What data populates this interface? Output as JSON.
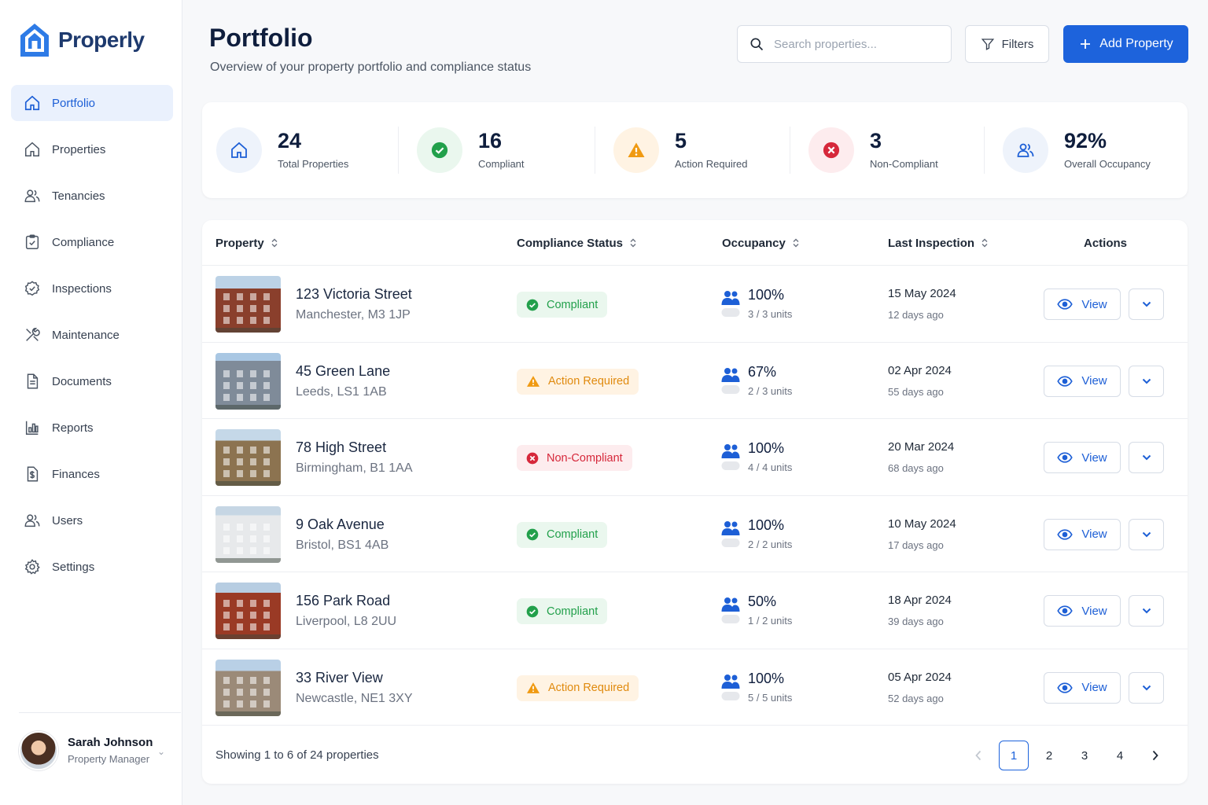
{
  "brand": {
    "name": "Properly"
  },
  "sidebar": {
    "items": [
      {
        "label": "Portfolio",
        "icon": "home-icon",
        "active": true
      },
      {
        "label": "Properties",
        "icon": "house-icon"
      },
      {
        "label": "Tenancies",
        "icon": "users-icon"
      },
      {
        "label": "Compliance",
        "icon": "clipboard-check-icon"
      },
      {
        "label": "Inspections",
        "icon": "check-circle-icon"
      },
      {
        "label": "Maintenance",
        "icon": "tools-icon"
      },
      {
        "label": "Documents",
        "icon": "document-icon"
      },
      {
        "label": "Reports",
        "icon": "bar-chart-icon"
      },
      {
        "label": "Finances",
        "icon": "money-icon"
      },
      {
        "label": "Users",
        "icon": "users-icon"
      },
      {
        "label": "Settings",
        "icon": "gear-icon"
      }
    ],
    "user": {
      "name": "Sarah Johnson",
      "role": "Property Manager"
    }
  },
  "header": {
    "title": "Portfolio",
    "subtitle": "Overview of your property portfolio and compliance status",
    "search_placeholder": "Search properties...",
    "filters_label": "Filters",
    "add_label": "Add Property"
  },
  "stats": [
    {
      "value": "24",
      "label": "Total Properties",
      "icon": "home-icon"
    },
    {
      "value": "16",
      "label": "Compliant",
      "icon": "check-circle-icon"
    },
    {
      "value": "5",
      "label": "Action Required",
      "icon": "warning-icon"
    },
    {
      "value": "3",
      "label": "Non-Compliant",
      "icon": "x-circle-icon"
    },
    {
      "value": "92%",
      "label": "Overall Occupancy",
      "icon": "users-icon"
    }
  ],
  "table": {
    "headers": {
      "property": "Property",
      "compliance": "Compliance Status",
      "occupancy": "Occupancy",
      "inspection": "Last Inspection",
      "actions": "Actions"
    },
    "view_label": "View",
    "rows": [
      {
        "name": "123 Victoria Street",
        "address": "Manchester, M3 1JP",
        "status": "Compliant",
        "status_kind": "ok",
        "occupancy": "100%",
        "units": "3 / 3 units",
        "date": "15 May 2024",
        "ago": "12 days ago"
      },
      {
        "name": "45 Green Lane",
        "address": "Leeds, LS1 1AB",
        "status": "Action Required",
        "status_kind": "warn",
        "occupancy": "67%",
        "units": "2 / 3 units",
        "date": "02 Apr 2024",
        "ago": "55 days ago"
      },
      {
        "name": "78 High Street",
        "address": "Birmingham, B1 1AA",
        "status": "Non-Compliant",
        "status_kind": "bad",
        "occupancy": "100%",
        "units": "4 / 4 units",
        "date": "20 Mar 2024",
        "ago": "68 days ago"
      },
      {
        "name": "9 Oak Avenue",
        "address": "Bristol, BS1 4AB",
        "status": "Compliant",
        "status_kind": "ok",
        "occupancy": "100%",
        "units": "2 / 2 units",
        "date": "10 May 2024",
        "ago": "17 days ago"
      },
      {
        "name": "156 Park Road",
        "address": "Liverpool, L8 2UU",
        "status": "Compliant",
        "status_kind": "ok",
        "occupancy": "50%",
        "units": "1 / 2 units",
        "date": "18 Apr 2024",
        "ago": "39 days ago"
      },
      {
        "name": "33 River View",
        "address": "Newcastle, NE1 3XY",
        "status": "Action Required",
        "status_kind": "warn",
        "occupancy": "100%",
        "units": "5 / 5 units",
        "date": "05 Apr 2024",
        "ago": "52 days ago"
      }
    ]
  },
  "pagination": {
    "summary": "Showing 1 to 6 of 24 properties",
    "pages": [
      "1",
      "2",
      "3",
      "4"
    ],
    "current": "1"
  },
  "colors": {
    "accent": "#1d63dc",
    "compliant": "#22a04b",
    "warning": "#e08a0e",
    "danger": "#d6283b"
  }
}
